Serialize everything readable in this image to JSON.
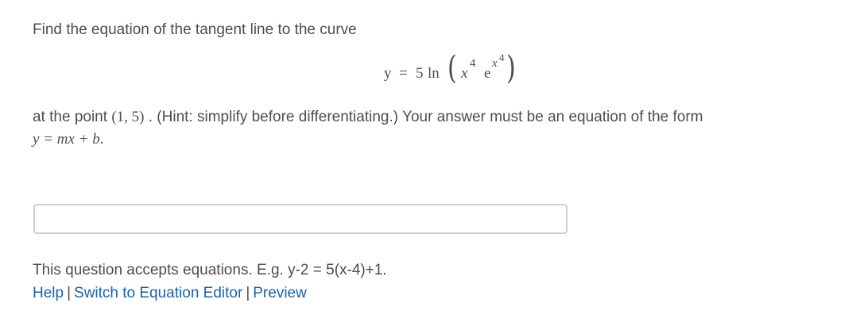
{
  "question": {
    "intro": "Find the equation of the tangent line to the curve",
    "equation": {
      "lhs": "y",
      "equals": "=",
      "coef": "5",
      "func": "ln",
      "x": "x",
      "exp4": "4",
      "e": "e",
      "ex": "x",
      "ex4": "4"
    },
    "at_text": "at the point",
    "point": "(1, 5)",
    "hint": ". (Hint: simplify before differentiating.) Your answer must be an equation of the form",
    "form": "y = mx + b",
    "form_end": "."
  },
  "answer": {
    "value": "",
    "placeholder": ""
  },
  "accepts_text": "This question accepts equations. E.g. y-2 = 5(x-4)+1.",
  "links": {
    "help": "Help",
    "sep1": "|",
    "switch": "Switch to Equation Editor",
    "sep2": "|",
    "preview": "Preview"
  }
}
